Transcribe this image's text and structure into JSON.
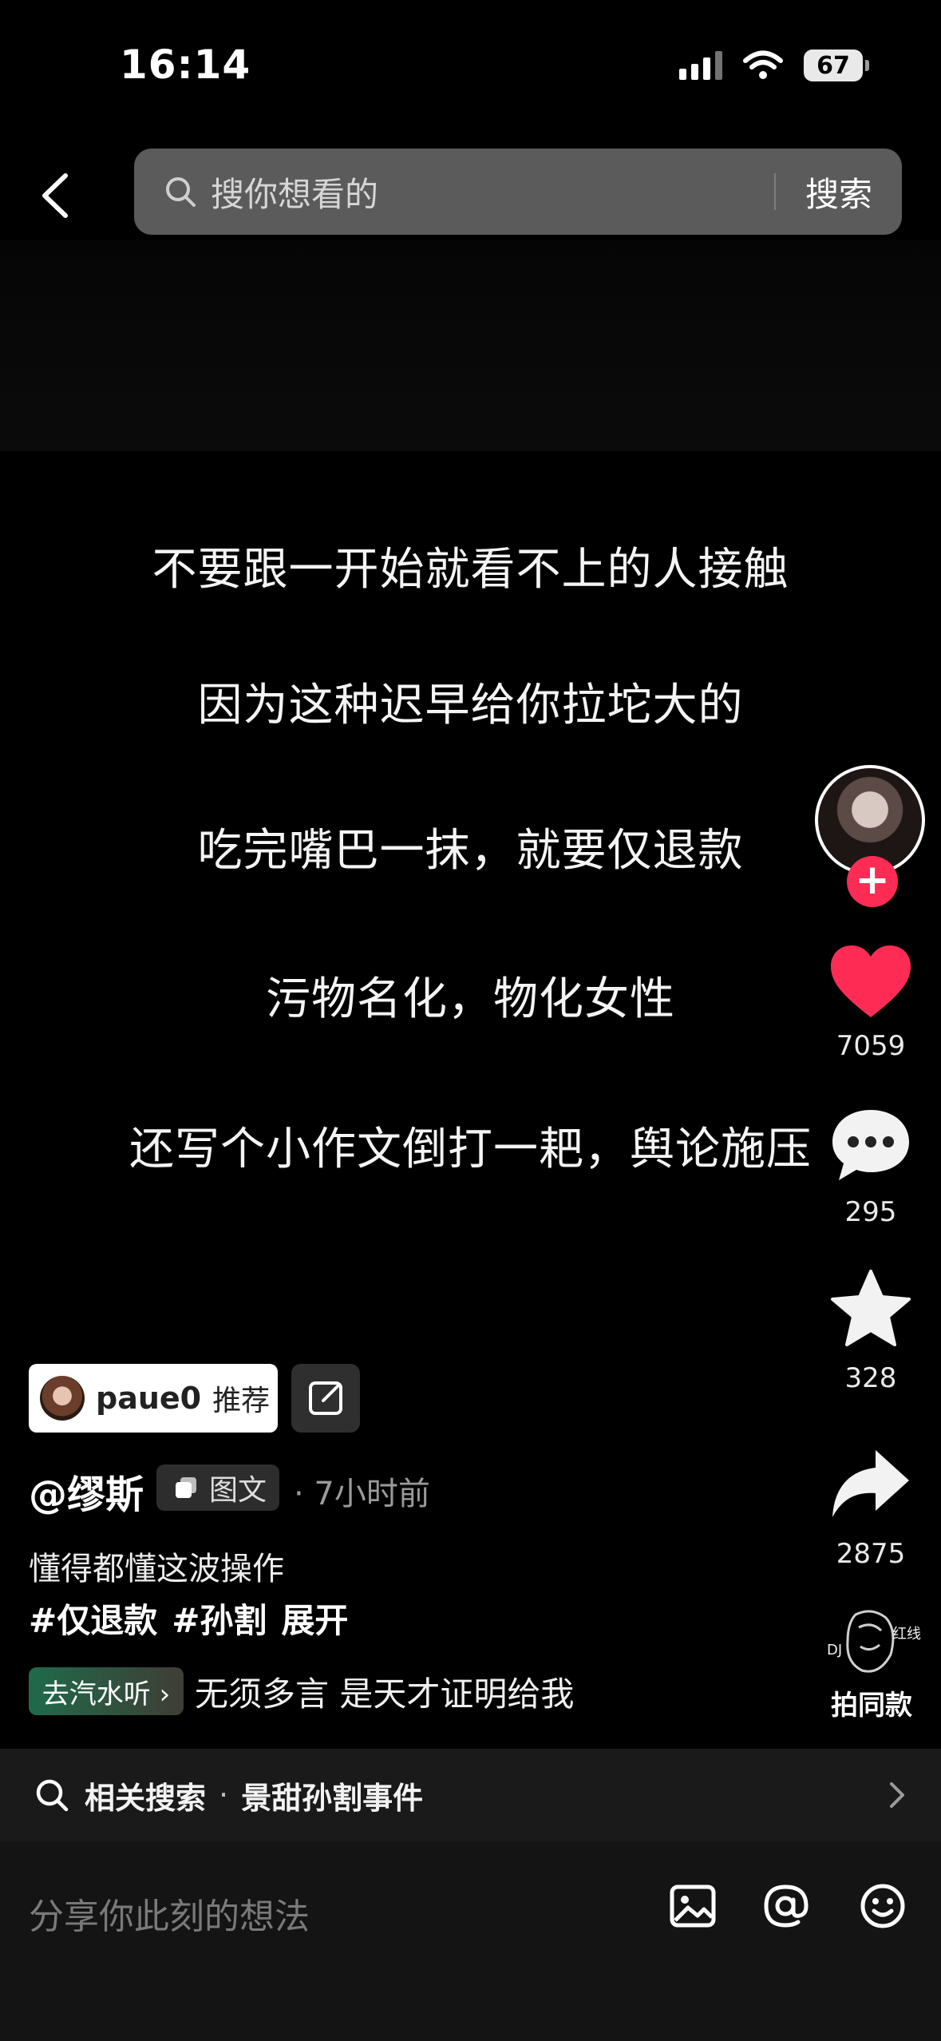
{
  "status_bar": {
    "time": "16:14",
    "battery": "67",
    "icons": [
      "signal-icon",
      "wifi-icon",
      "battery-icon"
    ]
  },
  "header": {
    "search_placeholder": "搜你想看的",
    "search_button": "搜索",
    "back_icon": "chevron-left-icon"
  },
  "post": {
    "lines": [
      "不要跟一开始就看不上的人接触",
      "因为这种迟早给你拉坨大的",
      "吃完嘴巴一抹，就要仅退款",
      "污物名化，物化女性",
      "还写个小作文倒打一耙，舆论施压"
    ]
  },
  "actions": {
    "likes": "7059",
    "comments": "295",
    "favorites": "328",
    "shares": "2875",
    "like_color": "#fe2c55"
  },
  "recommend": {
    "user": "paue0",
    "label": "推荐"
  },
  "author": {
    "name": "@缪斯",
    "type": "图文",
    "time": "· 7小时前"
  },
  "caption": {
    "text": "懂得都懂这波操作",
    "tags": [
      "#仅退款",
      "#孙割"
    ],
    "expand": "展开"
  },
  "music": {
    "badge": "去汽水听 ›",
    "title": "无须多言  是天才证明给我",
    "same_style_label": "拍同款"
  },
  "related_search": {
    "label": "相关搜索",
    "separator": "·",
    "query": "景甜孙割事件"
  },
  "comment_bar": {
    "placeholder": "分享你此刻的想法",
    "icons": [
      "image-icon",
      "at-icon",
      "emoji-icon"
    ]
  }
}
